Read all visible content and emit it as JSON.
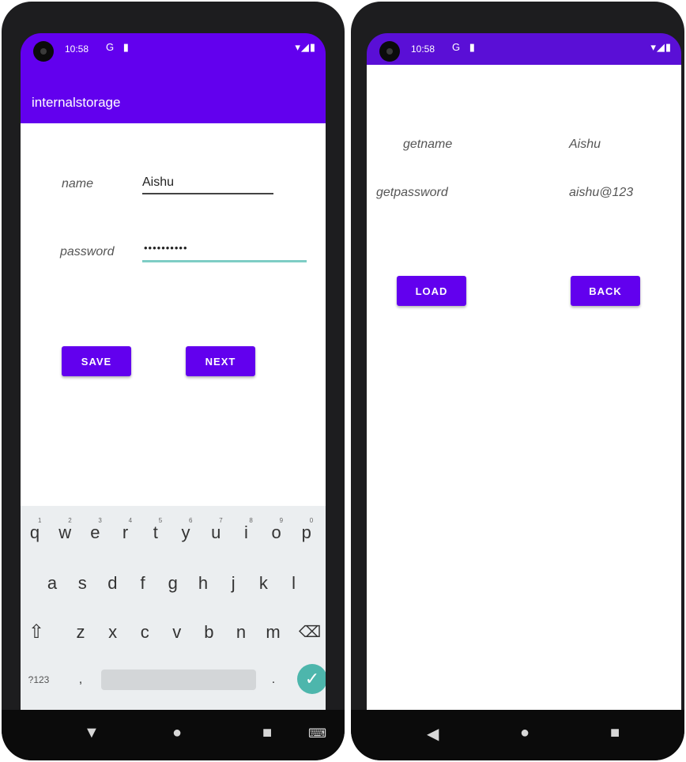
{
  "left_phone": {
    "status": {
      "time": "10:58",
      "left_icons": "G ▮",
      "right_icons": "▾◢▮"
    },
    "app_title": "internalstorage",
    "form": {
      "name_label": "name",
      "name_value": "Aishu",
      "password_label": "password",
      "password_value": "••••••••••"
    },
    "buttons": {
      "save": "SAVE",
      "next": "NEXT"
    },
    "keyboard": {
      "row1": [
        {
          "key": "q",
          "num": "1"
        },
        {
          "key": "w",
          "num": "2"
        },
        {
          "key": "e",
          "num": "3"
        },
        {
          "key": "r",
          "num": "4"
        },
        {
          "key": "t",
          "num": "5"
        },
        {
          "key": "y",
          "num": "6"
        },
        {
          "key": "u",
          "num": "7"
        },
        {
          "key": "i",
          "num": "8"
        },
        {
          "key": "o",
          "num": "9"
        },
        {
          "key": "p",
          "num": "0"
        }
      ],
      "row2": [
        "a",
        "s",
        "d",
        "f",
        "g",
        "h",
        "j",
        "k",
        "l"
      ],
      "row3": [
        "z",
        "x",
        "c",
        "v",
        "b",
        "n",
        "m"
      ],
      "symbols_key": "?123",
      "comma_key": ",",
      "period_key": ".",
      "shift_icon": "⇧",
      "backspace_icon": "⌫",
      "enter_icon": "✓"
    },
    "nav": {
      "back": "▼",
      "home": "●",
      "recents": "■",
      "keyboard": "⌨"
    }
  },
  "right_phone": {
    "status": {
      "time": "10:58",
      "left_icons": "G ▮",
      "right_icons": "▾◢▮"
    },
    "results": {
      "name_label": "getname",
      "name_value": "Aishu",
      "password_label": "getpassword",
      "password_value": "aishu@123"
    },
    "buttons": {
      "load": "LOAD",
      "back": "BACK"
    },
    "nav": {
      "back": "◀",
      "home": "●",
      "recents": "■"
    }
  }
}
